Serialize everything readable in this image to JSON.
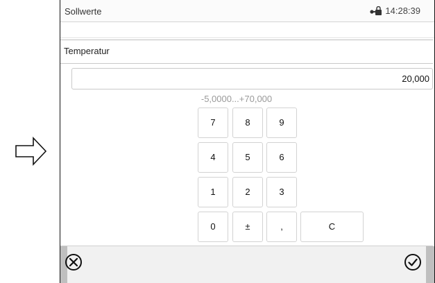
{
  "status_bar": {
    "title": "Sollwerte",
    "time": "14:28:39",
    "lock_icon": "lock-icon"
  },
  "dialog": {
    "title": "Temperatur",
    "value": "20,000",
    "range": "-5,0000...+70,000"
  },
  "keypad": {
    "rows": [
      [
        "7",
        "8",
        "9"
      ],
      [
        "4",
        "5",
        "6"
      ],
      [
        "1",
        "2",
        "3"
      ],
      [
        "0",
        "±",
        ",",
        "C"
      ]
    ]
  },
  "bottom_bar": {
    "cancel_icon": "cancel-icon",
    "confirm_icon": "checkmark-icon"
  },
  "indicator": {
    "icon": "arrow-right-icon"
  }
}
